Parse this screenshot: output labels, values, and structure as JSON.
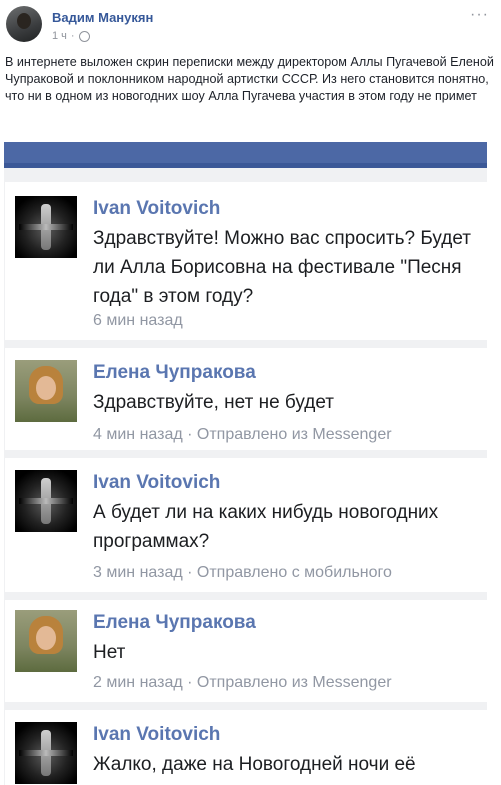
{
  "post": {
    "author": "Вадим Манукян",
    "time": "1 ч",
    "menu": "···",
    "text": "В интернете выложен скрин переписки между директором Аллы Пугачевой Еленой Чупраковой и поклонником народной артистки СССР. Из него становится понятно, что ни в одном из новогодних шоу Алла Пугачева участия в этом году не примет"
  },
  "comments": [
    {
      "author": "Ivan Voitovich",
      "text": "Здравствуйте! Можно вас спросить? Будет ли Алла Борисовна на фестивале \"Песня года\" в этом году?",
      "meta": "6 мин назад"
    },
    {
      "author": "Елена Чупракова",
      "text": "Здравствуйте, нет не будет",
      "meta": "4 мин назад · Отправлено из Messenger"
    },
    {
      "author": "Ivan Voitovich",
      "text": "А будет ли на каких нибудь новогодних программах?",
      "meta": "3 мин назад · Отправлено с мобильного"
    },
    {
      "author": "Елена Чупракова",
      "text": "Нет",
      "meta": "2 мин назад · Отправлено из Messenger"
    },
    {
      "author": "Ivan Voitovich",
      "text": "Жалко, даже на Новогодней ночи её",
      "meta": ""
    }
  ]
}
